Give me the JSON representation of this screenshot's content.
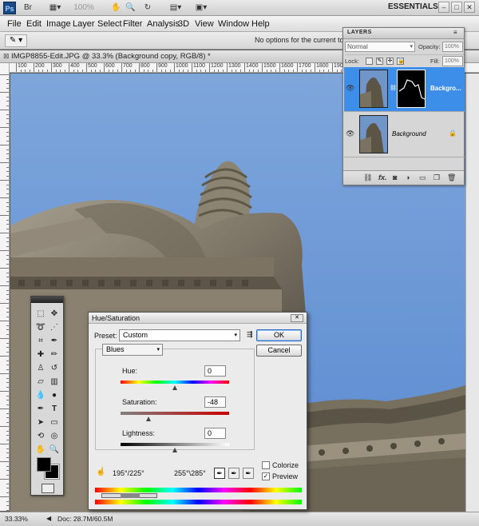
{
  "appbar": {
    "logo": "Ps",
    "zoom": "100%",
    "workspace": "ESSENTIALS",
    "window_buttons": [
      "–",
      "□",
      "✕"
    ]
  },
  "menu": [
    "File",
    "Edit",
    "Image",
    "Layer",
    "Select",
    "Filter",
    "Analysis",
    "3D",
    "View",
    "Window",
    "Help"
  ],
  "options_bar": {
    "message": "No options for the current tool."
  },
  "document": {
    "tab_title": "IMGP8855-Edit.JPG @ 33.3% (Background copy, RGB/8) *",
    "ruler_labels": [
      "100",
      "200",
      "300",
      "400",
      "500",
      "600",
      "700",
      "800",
      "900",
      "1000",
      "1100",
      "1200",
      "1300",
      "1400",
      "1500",
      "1600",
      "1700",
      "1800",
      "1900",
      "2000",
      "2100",
      "2200",
      "2300",
      "2400",
      "2500"
    ]
  },
  "status": {
    "zoom": "33.33%",
    "doc": "Doc: 28.7M/60.5M"
  },
  "layers": {
    "title": "LAYERS",
    "blend": "Normal",
    "opacity_label": "Opacity:",
    "opacity": "100%",
    "lock_label": "Lock:",
    "fill_label": "Fill:",
    "fill": "100%",
    "items": [
      {
        "name": "Backgro...",
        "selected": true
      },
      {
        "name": "Background",
        "selected": false
      }
    ],
    "bottom_icons": [
      "link-icon",
      "fx-icon",
      "mask-icon",
      "adjustment-icon",
      "folder-icon",
      "new-layer-icon",
      "trash-icon"
    ],
    "fx": "fx."
  },
  "dialog": {
    "title": "Hue/Saturation",
    "preset_label": "Preset:",
    "preset_value": "Custom",
    "ok": "OK",
    "cancel": "Cancel",
    "channel": "Blues",
    "hue_label": "Hue:",
    "hue": "0",
    "saturation_label": "Saturation:",
    "saturation": "-48",
    "lightness_label": "Lightness:",
    "lightness": "0",
    "range_left": "195°/225°",
    "range_right": "255°\\285°",
    "colorize_label": "Colorize",
    "preview_label": "Preview",
    "colorize": false,
    "preview": true
  }
}
